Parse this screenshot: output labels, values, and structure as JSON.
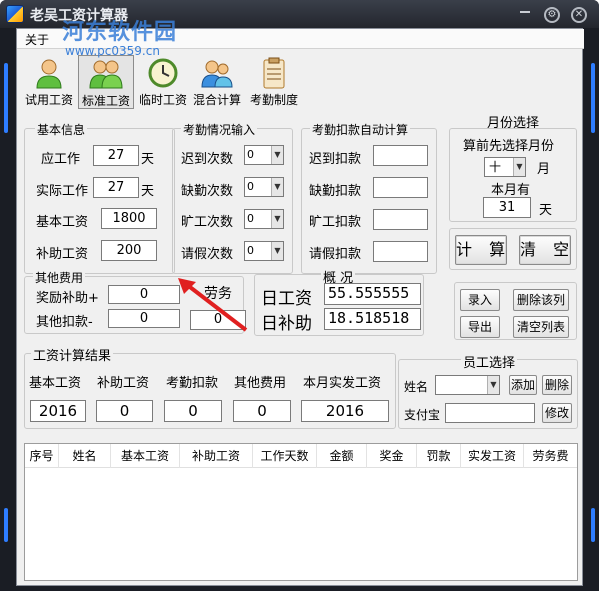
{
  "window": {
    "title": "老吴工资计算器",
    "controls": [
      "minimize",
      "settings",
      "close"
    ]
  },
  "watermark": {
    "text": "河东软件园",
    "url": "www.pc0359.cn"
  },
  "menubar": {
    "items": [
      "关于"
    ]
  },
  "toolbar": {
    "items": [
      {
        "label": "试用工资",
        "icon": "person-icon"
      },
      {
        "label": "标准工资",
        "icon": "people-icon",
        "active": true
      },
      {
        "label": "临时工资",
        "icon": "clock-icon"
      },
      {
        "label": "混合计算",
        "icon": "group-icon"
      },
      {
        "label": "考勤制度",
        "icon": "clipboard-icon"
      }
    ]
  },
  "basic_info": {
    "title": "基本信息",
    "should_work_label": "应工作",
    "should_work": "27",
    "should_work_unit": "天",
    "actual_work_label": "实际工作",
    "actual_work": "27",
    "actual_work_unit": "天",
    "base_salary_label": "基本工资",
    "base_salary": "1800",
    "allowance_label": "补助工资",
    "allowance": "200"
  },
  "attendance_input": {
    "title": "考勤情况输入",
    "late_label": "迟到次数",
    "late": "0",
    "absent_label": "缺勤次数",
    "absent": "0",
    "skip_label": "旷工次数",
    "skip": "0",
    "leave_label": "请假次数",
    "leave": "0"
  },
  "attendance_deduct": {
    "title": "考勤扣款自动计算",
    "late_label": "迟到扣款",
    "late": "",
    "absent_label": "缺勤扣款",
    "absent": "",
    "skip_label": "旷工扣款",
    "skip": "",
    "leave_label": "请假扣款",
    "leave": ""
  },
  "month_select": {
    "title": "月份选择",
    "hint": "算前先选择月份",
    "month": "十",
    "month_unit": "月",
    "days_label": "本月有",
    "days": "31",
    "days_unit": "天"
  },
  "actions": {
    "calc": "计 算",
    "clear": "清 空",
    "enter": "录入",
    "delete_row": "删除该列",
    "export": "导出",
    "clear_list": "清空列表"
  },
  "other_fees": {
    "title": "其他费用",
    "bonus_label": "奖励补助+",
    "bonus": "0",
    "deduct_label": "其他扣款-",
    "deduct": "0",
    "labor_label": "劳务",
    "labor": "0"
  },
  "overview": {
    "title": "概 况",
    "daily_wage_label": "日工资",
    "daily_wage": "55.555555",
    "daily_allowance_label": "日补助",
    "daily_allowance": "18.518518"
  },
  "results": {
    "title": "工资计算结果",
    "base_label": "基本工资",
    "base": "2016",
    "allowance_label": "补助工资",
    "allowance": "0",
    "attendance_label": "考勤扣款",
    "attendance": "0",
    "other_label": "其他费用",
    "other": "0",
    "net_label": "本月实发工资",
    "net": "2016"
  },
  "employee": {
    "title": "员工选择",
    "name_label": "姓名",
    "name": "",
    "add": "添加",
    "delete": "删除",
    "alipay_label": "支付宝",
    "alipay": "",
    "modify": "修改"
  },
  "table": {
    "columns": [
      "序号",
      "姓名",
      "基本工资",
      "补助工资",
      "工作天数",
      "金额",
      "奖金",
      "罚款",
      "实发工资",
      "劳务费"
    ],
    "rows": []
  },
  "colors": {
    "frame": "#1a1d24",
    "accent_glow": "#2e7dff",
    "annotation_arrow": "#e02020",
    "watermark": "#3a7fd8"
  }
}
